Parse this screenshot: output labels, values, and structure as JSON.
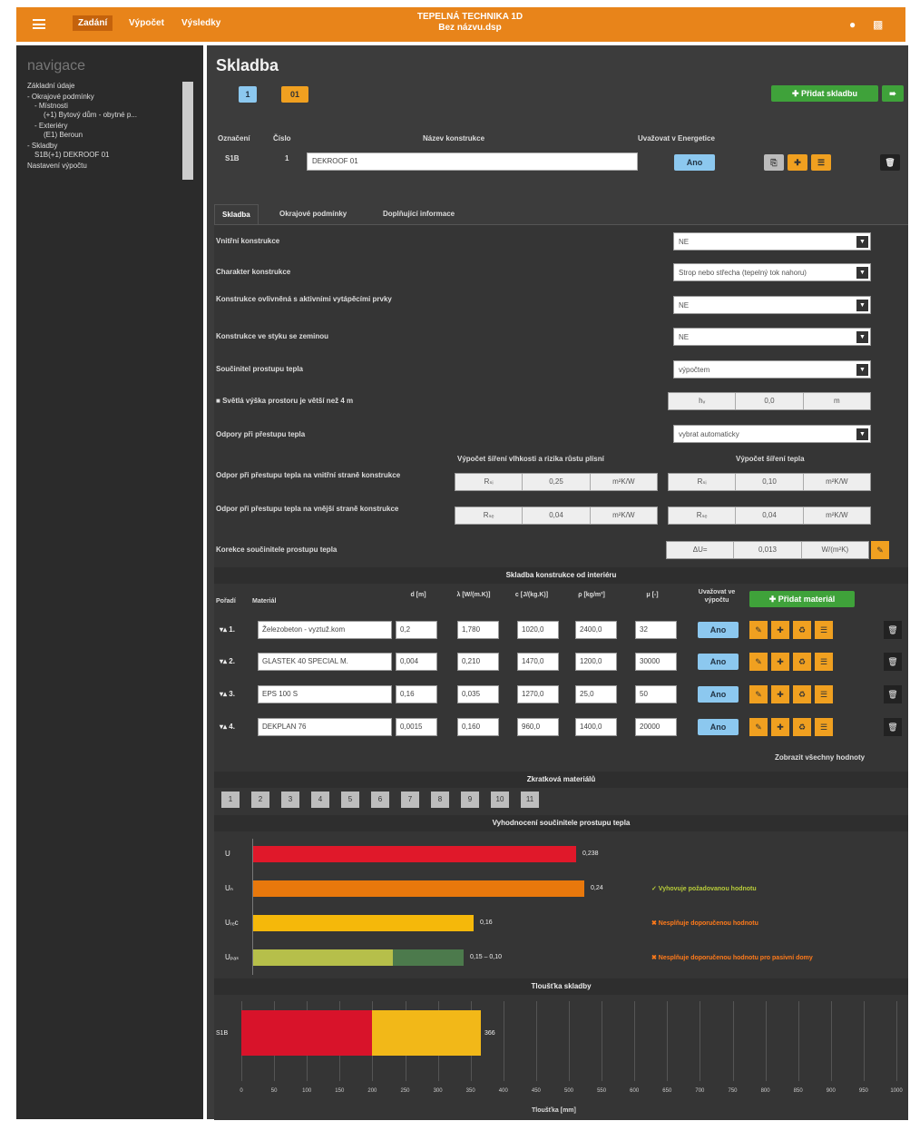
{
  "topbar": {
    "tabs": [
      "Zadání",
      "Výpočet",
      "Výsledky"
    ],
    "title_line1": "TEPELNÁ TECHNIKA 1D",
    "title_line2": "Bez názvu.dsp",
    "icons": [
      "menu-icon",
      "user-icon",
      "print-icon"
    ]
  },
  "nav": {
    "title": "navigace",
    "items": [
      "Základní údaje",
      "- Okrajové podmínky",
      "  - Místnosti",
      "    (+1) Bytový dům - obytné p...",
      "  - Exteriéry",
      "    (E1) Beroun",
      "- Skladby",
      "  S1B(+1) DEKROOF 01",
      "Nastavení výpočtu"
    ]
  },
  "main": {
    "title": "Skladba",
    "tab_buttons": [
      "1",
      "01"
    ],
    "add_composition": "Přidat skladbu",
    "header_labels": {
      "code": "Označení",
      "number": "Číslo",
      "name": "Název konstrukce",
      "energy": "Uvažovat v Energetice"
    },
    "code_value": "S1B",
    "number_value": "1",
    "name_value": "DEKROOF 01",
    "energy_value": "Ano",
    "tabs": [
      "Skladba",
      "Okrajové podmínky",
      "Doplňující informace"
    ]
  },
  "props": [
    {
      "label": "Vnitřní konstrukce",
      "value": "NE"
    },
    {
      "label": "Charakter konstrukce",
      "value": "Strop nebo střecha (tepelný tok nahoru)"
    },
    {
      "label": "Konstrukce ovlivněná s aktivními vytápěcími prvky",
      "value": "NE"
    },
    {
      "label": "Konstrukce ve styku se zeminou",
      "value": "NE"
    },
    {
      "label": "Součinitel prostupu tepla",
      "value": "výpočtem"
    },
    {
      "label": "Světlá výška prostoru je větší než 4 m",
      "value": ""
    },
    {
      "label": "Odpory při přestupu tepla",
      "value": "vybrat automaticky"
    },
    {
      "label": "Odpor při přestupu tepla na vnitřní straně konstrukce",
      "value": ""
    },
    {
      "label": "Odpor při přestupu tepla na vnější straně konstrukce",
      "value": ""
    },
    {
      "label": "Korekce součinitele prostupu tepla",
      "value": ""
    }
  ],
  "height_row": {
    "symbol": "hᵥ",
    "value": "0,0",
    "unit": "m"
  },
  "resistance_headers": {
    "left": "Výpočet šíření vlhkosti a rizika růstu plísní",
    "right": "Výpočet šíření tepla"
  },
  "rsi_left": {
    "symbol": "Rₛᵢ",
    "value": "0,25",
    "unit": "m²K/W"
  },
  "rsi_right": {
    "symbol": "Rₛᵢ",
    "value": "0,10",
    "unit": "m²K/W"
  },
  "rse_left": {
    "symbol": "Rₛₑ",
    "value": "0,04",
    "unit": "m²K/W"
  },
  "rse_right": {
    "symbol": "Rₛₑ",
    "value": "0,04",
    "unit": "m²K/W"
  },
  "du_row": {
    "symbol": "ΔU=",
    "value": "0,013",
    "unit": "W/(m²K)"
  },
  "layers": {
    "title": "Skladba konstrukce od interiéru",
    "col_headers": [
      "Pořadí",
      "Materiál",
      "d [m]",
      "λ [W/(m.K)]",
      "c [J/(kg.K)]",
      "ρ [kg/m³]",
      "μ [-]",
      "Uvažovat ve výpočtu"
    ],
    "add_material": "Přidat materiál",
    "rows": [
      {
        "order": "1.",
        "material": "Železobeton - vyztuž.kom",
        "d": "0,2",
        "lambda": "1,780",
        "c": "1020,0",
        "rho": "2400,0",
        "mu": "32",
        "use": "Ano"
      },
      {
        "order": "2.",
        "material": "GLASTEK 40 SPECIAL M.",
        "d": "0,004",
        "lambda": "0,210",
        "c": "1470,0",
        "rho": "1200,0",
        "mu": "30000",
        "use": "Ano"
      },
      {
        "order": "3.",
        "material": "EPS 100 S",
        "d": "0,16",
        "lambda": "0,035",
        "c": "1270,0",
        "rho": "25,0",
        "mu": "50",
        "use": "Ano"
      },
      {
        "order": "4.",
        "material": "DEKPLAN 76",
        "d": "0,0015",
        "lambda": "0,160",
        "c": "960,0",
        "rho": "1400,0",
        "mu": "20000",
        "use": "Ano"
      }
    ],
    "show_all": "Zobrazit všechny hodnoty"
  },
  "shortcuts": {
    "title": "Zkratková materiálů",
    "items": [
      "1",
      "2",
      "3",
      "4",
      "5",
      "6",
      "7",
      "8",
      "9",
      "10",
      "11"
    ]
  },
  "u_chart": {
    "title": "Vyhodnocení součinitele prostupu tepla",
    "rows": [
      {
        "label": "U",
        "value": "0,238",
        "color": "#e0182a",
        "frac": 0.66,
        "verdict": ""
      },
      {
        "label": "Uₙ",
        "value": "0,24",
        "color": "#e8780c",
        "frac": 0.675,
        "verdict": "✓ Vyhovuje požadovanou hodnotu"
      },
      {
        "label": "Uᵣₑc",
        "value": "0,16",
        "color": "#f5b80a",
        "frac": 0.45,
        "verdict": "✖ Nesplňuje doporučenou hodnotu"
      },
      {
        "label": "Uₚₐₛ",
        "value": "0,15 – 0,10",
        "color": "#b6bf4a",
        "frac": 0.43,
        "verdict": "✖ Nesplňuje doporučenou hodnotu pro pasivní domy"
      }
    ]
  },
  "thickness_chart": {
    "title": "Tloušťka skladby",
    "xlabel": "Tloušťka [mm]",
    "left_label": "S1B",
    "right_label": "366",
    "ticks": [
      "0",
      "50",
      "100",
      "150",
      "200",
      "250",
      "300",
      "350",
      "400",
      "450",
      "500",
      "550",
      "600",
      "650",
      "700",
      "750",
      "800",
      "850",
      "900",
      "950",
      "1000"
    ]
  }
}
